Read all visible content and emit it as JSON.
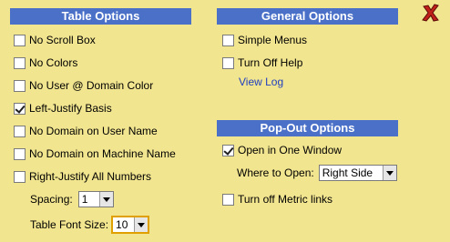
{
  "table_options": {
    "header": "Table Options",
    "items": [
      {
        "label": "No Scroll Box",
        "checked": false
      },
      {
        "label": "No Colors",
        "checked": false
      },
      {
        "label": "No User @ Domain Color",
        "checked": false
      },
      {
        "label": "Left-Justify Basis",
        "checked": true
      },
      {
        "label": "No Domain on User Name",
        "checked": false
      },
      {
        "label": "No Domain on Machine Name",
        "checked": false
      },
      {
        "label": "Right-Justify All Numbers",
        "checked": false
      }
    ],
    "spacing_label": "Spacing:",
    "spacing_value": "1",
    "font_size_label": "Table Font Size:",
    "font_size_value": "10"
  },
  "general_options": {
    "header": "General Options",
    "items": [
      {
        "label": "Simple Menus",
        "checked": false
      },
      {
        "label": "Turn Off Help",
        "checked": false
      }
    ],
    "view_log_link": "View Log"
  },
  "popout_options": {
    "header": "Pop-Out Options",
    "open_one_window_label": "Open in One Window",
    "open_one_window_checked": true,
    "where_label": "Where to Open:",
    "where_value": "Right Side",
    "metric_links_label": "Turn off Metric links",
    "metric_links_checked": false
  },
  "colors": {
    "background": "#f2e58f",
    "header": "#4a70c8",
    "link": "#1f3fbf",
    "close": "#c0201a"
  },
  "icons": {
    "close": "close-icon"
  }
}
